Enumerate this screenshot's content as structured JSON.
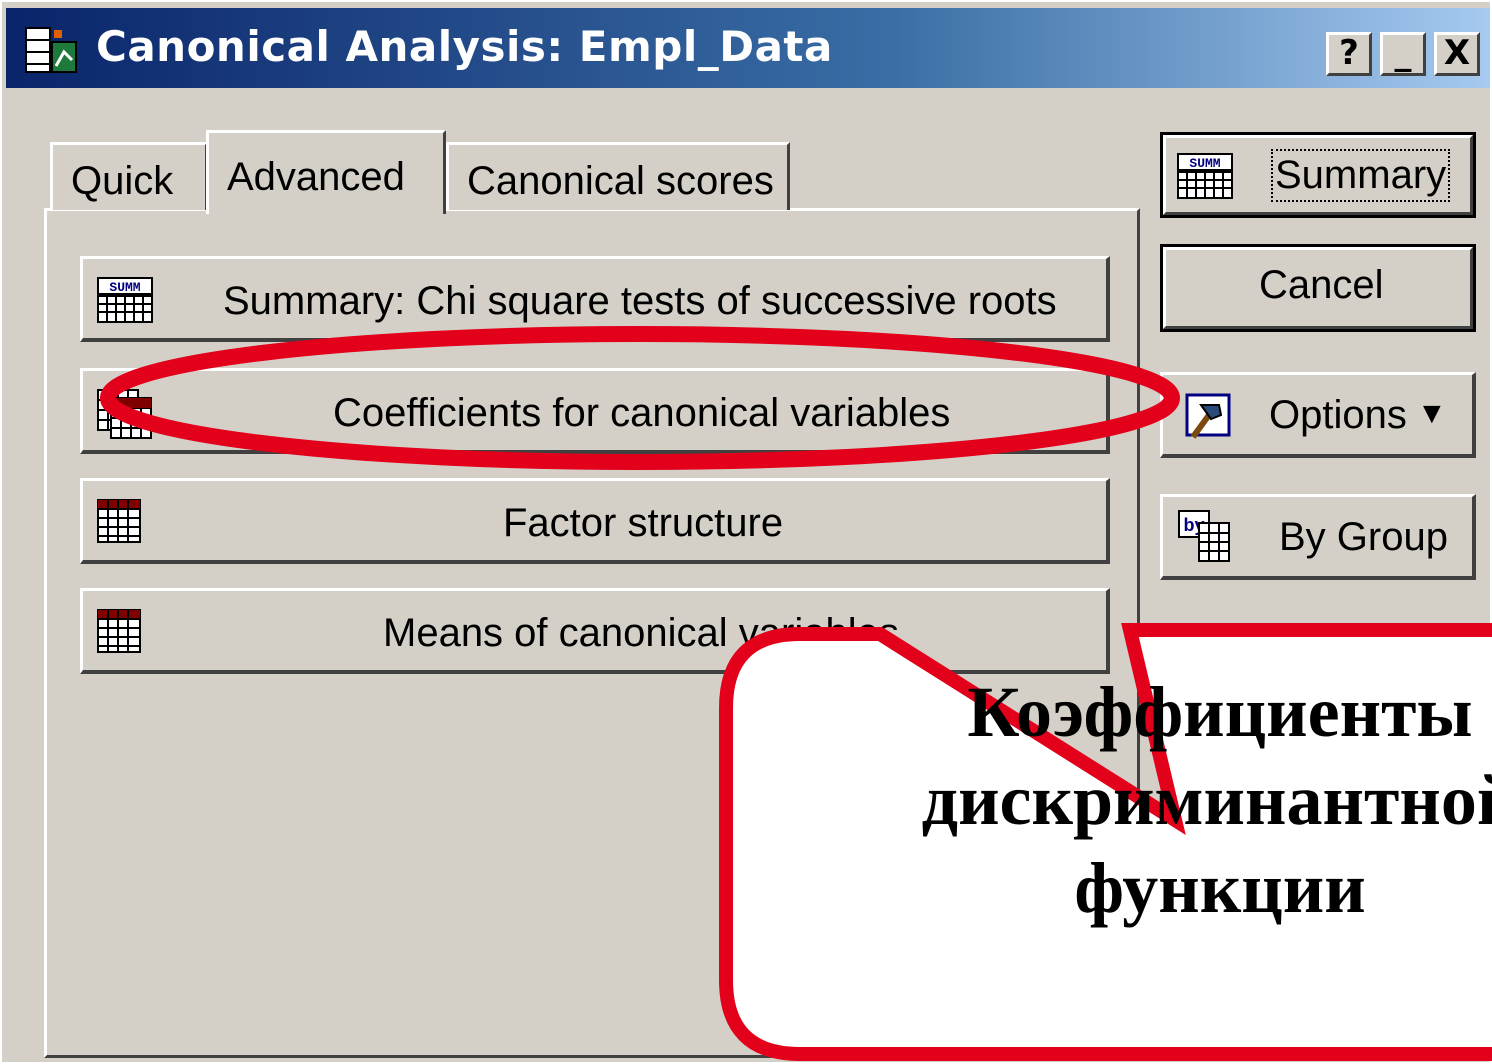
{
  "window": {
    "title": "Canonical Analysis: Empl_Data",
    "controls": {
      "help": "?",
      "minimize": "_",
      "close": "X"
    }
  },
  "tabs": [
    {
      "label": "Quick",
      "active": false
    },
    {
      "label": "Advanced",
      "active": true
    },
    {
      "label": "Canonical scores",
      "active": false
    }
  ],
  "panel_buttons": {
    "summary_chi": {
      "label": "Summary:  Chi square tests of successive roots",
      "icon": "summary-grid-icon"
    },
    "coefficients": {
      "label": "Coefficients for canonical variables",
      "icon": "spreadsheet-icon"
    },
    "factor": {
      "label": "Factor structure",
      "icon": "spreadsheet-icon"
    },
    "means": {
      "label": "Means of canonical variables",
      "icon": "spreadsheet-icon"
    }
  },
  "side_buttons": {
    "summary": {
      "label": "Summary",
      "icon": "summary-grid-icon"
    },
    "cancel": {
      "label": "Cancel"
    },
    "options": {
      "label": "Options",
      "icon": "hammer-icon",
      "arrow": "▼"
    },
    "bygroup": {
      "label": "By Group",
      "icon": "by-group-icon"
    }
  },
  "annotation": {
    "callout_text": "Коэффициенты\nдискриминантной\nфункции",
    "highlight_color": "#e3001b"
  }
}
